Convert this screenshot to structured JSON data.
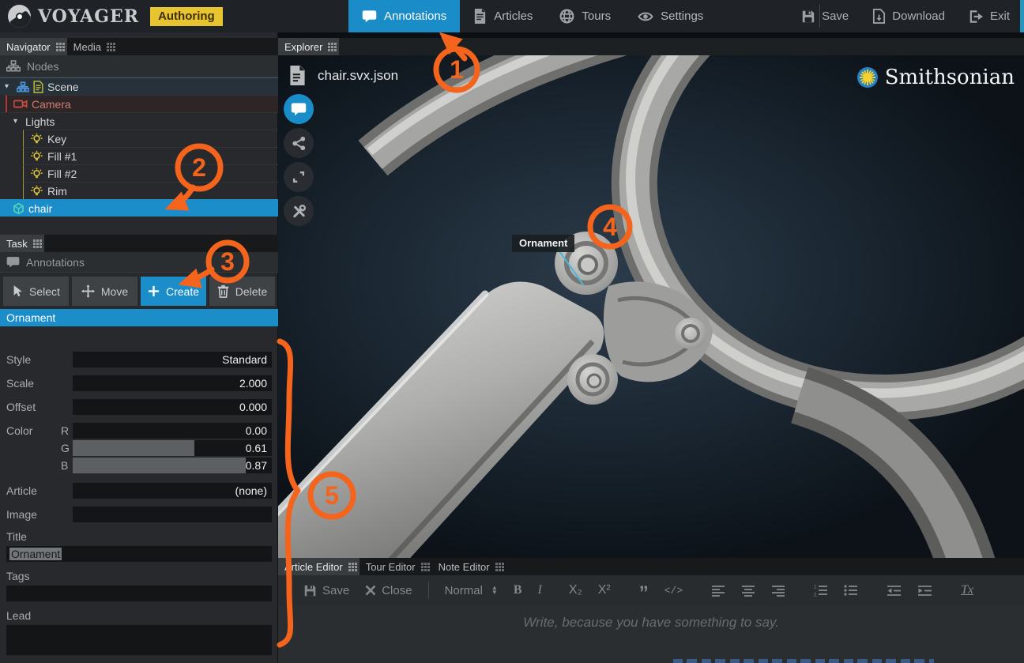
{
  "colors": {
    "accent_blue": "#1b8dc9",
    "orange": "#f4641c",
    "badge_yellow": "#e9c431"
  },
  "topbar": {
    "logo_text": "VOYAGER",
    "badge": "Authoring",
    "tabs": [
      {
        "label": "Annotations",
        "icon": "speech-bubble",
        "active": true
      },
      {
        "label": "Articles",
        "icon": "document",
        "active": false
      },
      {
        "label": "Tours",
        "icon": "globe",
        "active": false
      },
      {
        "label": "Settings",
        "icon": "eye",
        "active": false
      }
    ],
    "actions": [
      {
        "label": "Save",
        "icon": "save"
      },
      {
        "label": "Download",
        "icon": "download"
      },
      {
        "label": "Exit",
        "icon": "exit"
      }
    ]
  },
  "navigator": {
    "tabs": [
      {
        "label": "Navigator",
        "active": true
      },
      {
        "label": "Media",
        "active": false
      }
    ],
    "header": "Nodes",
    "tree": [
      {
        "label": "Scene",
        "type": "scene"
      },
      {
        "label": "Camera",
        "type": "camera"
      },
      {
        "label": "Lights",
        "type": "group"
      },
      {
        "label": "Key",
        "type": "light"
      },
      {
        "label": "Fill #1",
        "type": "light"
      },
      {
        "label": "Fill #2",
        "type": "light"
      },
      {
        "label": "Rim",
        "type": "light"
      },
      {
        "label": "chair",
        "type": "model",
        "selected": true
      }
    ]
  },
  "task": {
    "tab": "Task",
    "header": "Annotations",
    "buttons": [
      {
        "label": "Select",
        "active": false
      },
      {
        "label": "Move",
        "active": false
      },
      {
        "label": "Create",
        "active": true
      },
      {
        "label": "Delete",
        "active": false
      }
    ],
    "list": [
      {
        "label": "Ornament",
        "selected": true
      }
    ],
    "properties": {
      "style": {
        "label": "Style",
        "value": "Standard"
      },
      "scale": {
        "label": "Scale",
        "value": "2.000"
      },
      "offset": {
        "label": "Offset",
        "value": "0.000"
      },
      "color": {
        "label": "Color",
        "channels": [
          {
            "label": "R",
            "value": "0.00",
            "fill": "0%"
          },
          {
            "label": "G",
            "value": "0.61",
            "fill": "61%"
          },
          {
            "label": "B",
            "value": "0.87",
            "fill": "87%"
          }
        ]
      },
      "article": {
        "label": "Article",
        "value": "(none)"
      },
      "image": {
        "label": "Image",
        "value": ""
      },
      "title": {
        "label": "Title",
        "value": "Ornament"
      },
      "tags": {
        "label": "Tags",
        "value": ""
      },
      "lead": {
        "label": "Lead",
        "value": ""
      }
    }
  },
  "explorer": {
    "tab": "Explorer",
    "file_name": "chair.svx.json",
    "tool_buttons": [
      "annotations",
      "share",
      "fullscreen",
      "tools"
    ],
    "annotation_label": "Ornament",
    "brand": "Smithsonian"
  },
  "editor": {
    "tabs": [
      {
        "label": "Article Editor",
        "active": true
      },
      {
        "label": "Tour Editor",
        "active": false
      },
      {
        "label": "Note Editor",
        "active": false
      }
    ],
    "toolbar": {
      "save": "Save",
      "close": "Close",
      "paragraph_style": "Normal",
      "bold": "B",
      "italic": "I",
      "subscript": "X₂",
      "superscript": "X²",
      "blockquote": "”",
      "code": "</>",
      "clear_format": "Tx"
    },
    "placeholder": "Write, because you have something to say."
  },
  "overlay": {
    "steps": [
      "1",
      "2",
      "3",
      "4",
      "5"
    ]
  }
}
